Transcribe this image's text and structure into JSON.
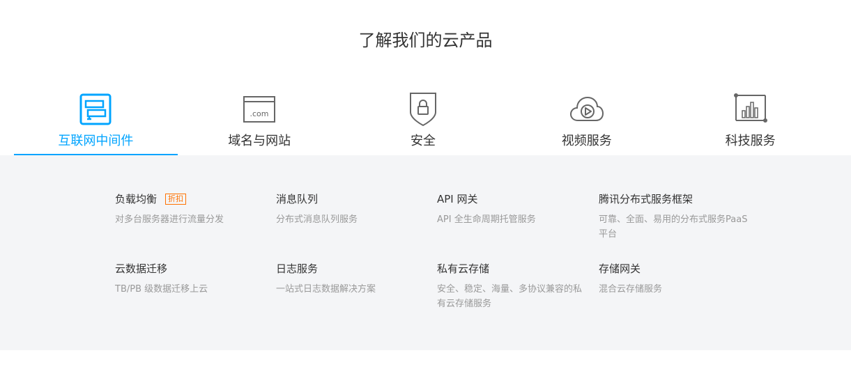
{
  "section": {
    "title": "了解我们的云产品"
  },
  "colors": {
    "accent": "#00a4ff",
    "badge": "#ff7200",
    "panel_bg": "#f4f5f7"
  },
  "tabs": [
    {
      "label": "互联网中间件",
      "icon": "middleware-icon",
      "active": true
    },
    {
      "label": "域名与网站",
      "icon": "domain-icon",
      "icon_text": ".com",
      "active": false
    },
    {
      "label": "安全",
      "icon": "shield-lock-icon",
      "active": false
    },
    {
      "label": "视频服务",
      "icon": "cloud-play-icon",
      "active": false
    },
    {
      "label": "科技服务",
      "icon": "chart-board-icon",
      "active": false
    }
  ],
  "products": [
    {
      "name": "负载均衡",
      "badge": "折扣",
      "desc": "对多台服务器进行流量分发"
    },
    {
      "name": "消息队列",
      "desc": "分布式消息队列服务"
    },
    {
      "name": "API 网关",
      "desc": "API 全生命周期托管服务"
    },
    {
      "name": "腾讯分布式服务框架",
      "desc": "可靠、全面、易用的分布式服务PaaS平台"
    },
    {
      "name": "云数据迁移",
      "desc": "TB/PB 级数据迁移上云"
    },
    {
      "name": "日志服务",
      "desc": "一站式日志数据解决方案"
    },
    {
      "name": "私有云存储",
      "desc": "安全、稳定、海量、多协议兼容的私有云存储服务"
    },
    {
      "name": "存储网关",
      "desc": "混合云存储服务"
    }
  ]
}
